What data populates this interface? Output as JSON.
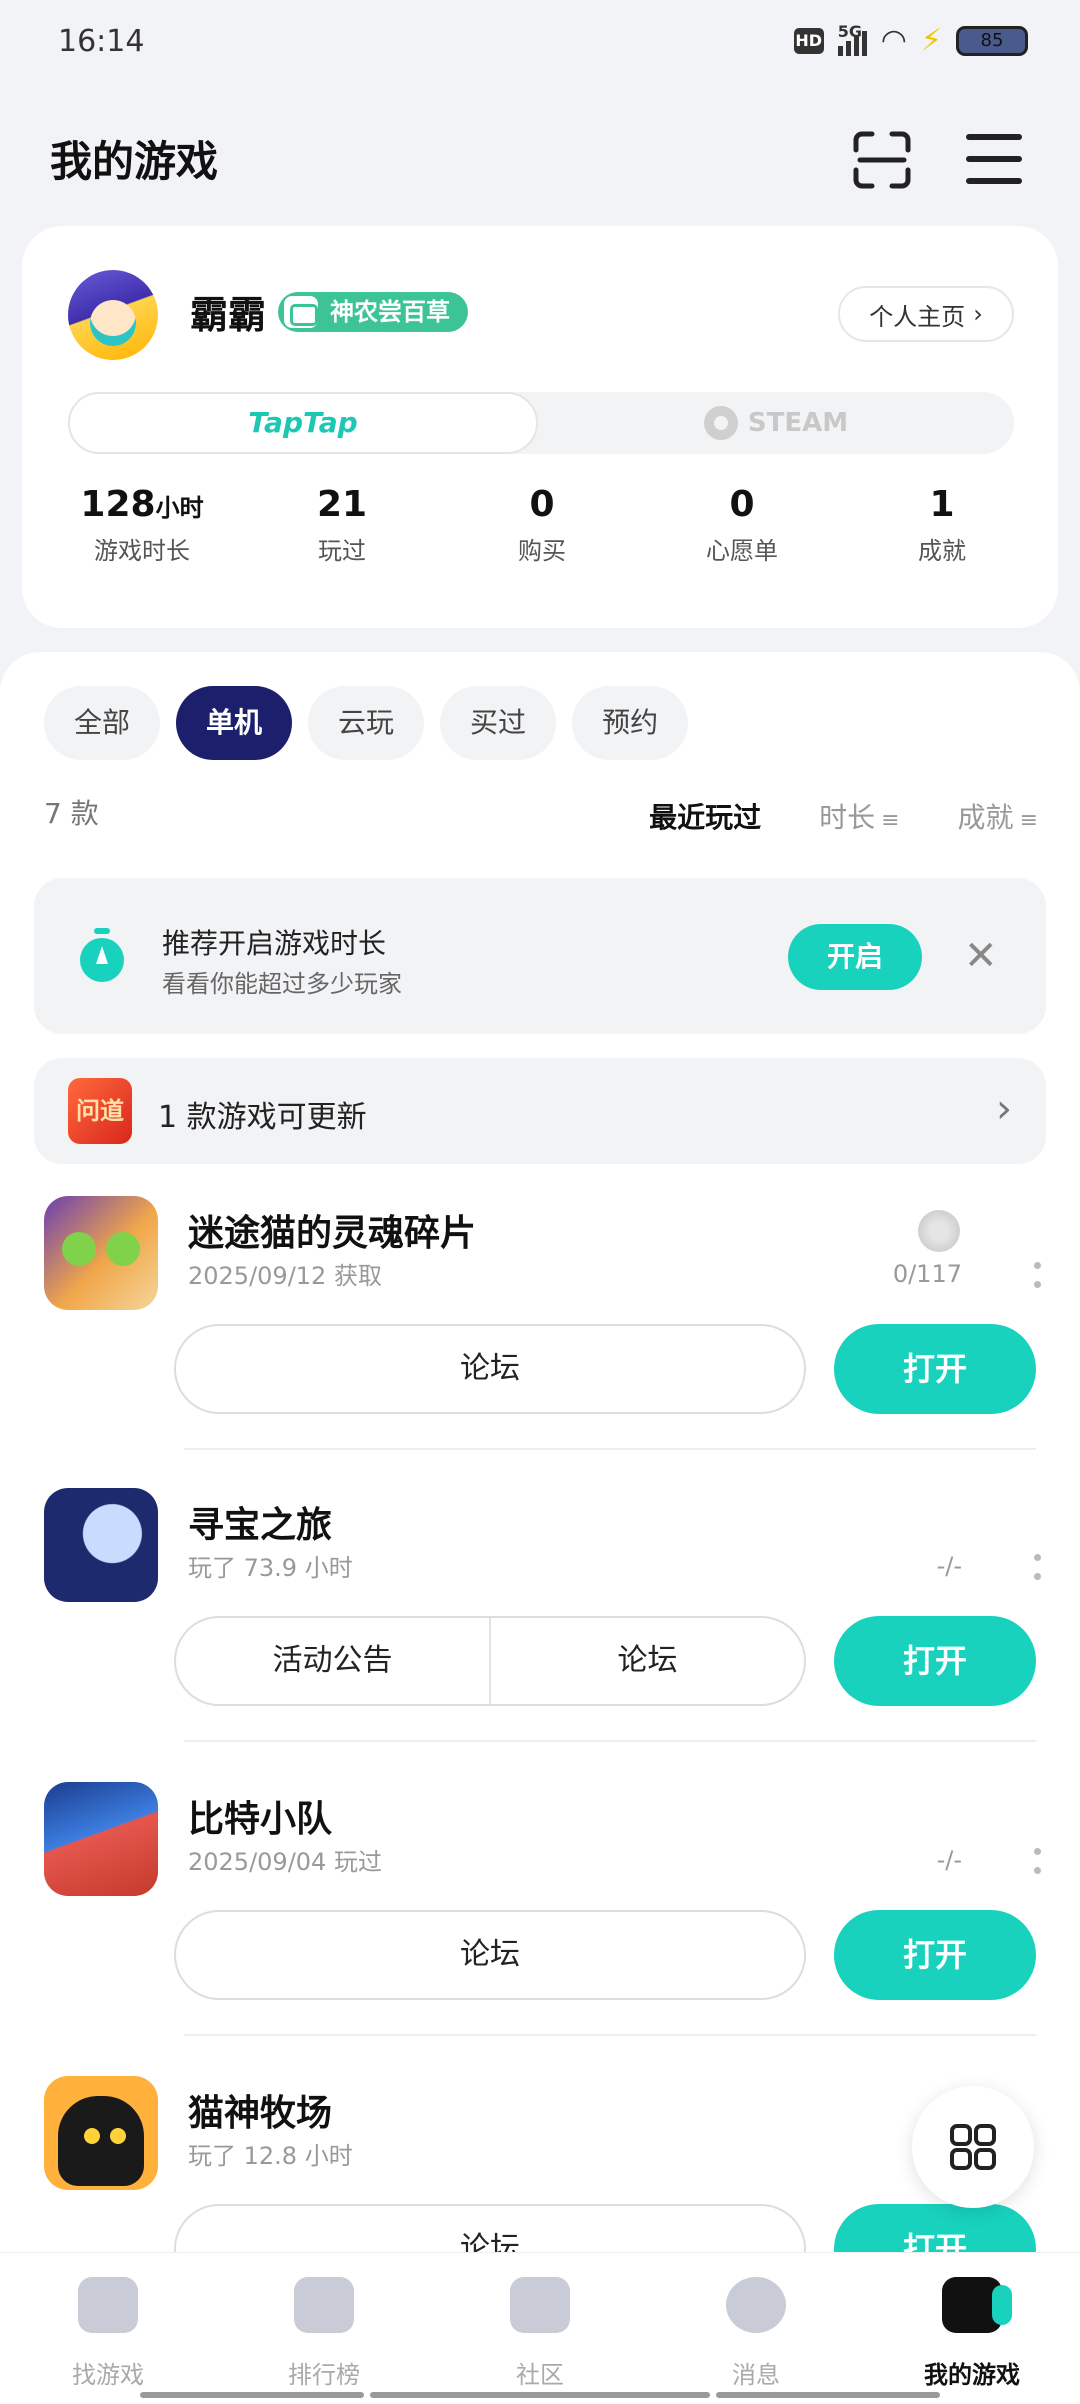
{
  "status_bar": {
    "time": "16:14",
    "network": "5G",
    "hd": "HD",
    "battery": "85"
  },
  "header": {
    "title": "我的游戏"
  },
  "profile": {
    "username": "霸霸",
    "badge": "神农尝百草",
    "home_button": "个人主页",
    "platforms": {
      "taptap": "TapTap",
      "steam": "STEAM",
      "selected": "TapTap"
    },
    "stats": [
      {
        "value": "128",
        "unit": "小时",
        "label": "游戏时长"
      },
      {
        "value": "21",
        "unit": "",
        "label": "玩过"
      },
      {
        "value": "0",
        "unit": "",
        "label": "购买"
      },
      {
        "value": "0",
        "unit": "",
        "label": "心愿单"
      },
      {
        "value": "1",
        "unit": "",
        "label": "成就"
      }
    ]
  },
  "filters": {
    "tabs": [
      {
        "label": "全部",
        "active": false
      },
      {
        "label": "单机",
        "active": true
      },
      {
        "label": "云玩",
        "active": false
      },
      {
        "label": "买过",
        "active": false
      },
      {
        "label": "预约",
        "active": false
      }
    ],
    "count": "7 款",
    "sorts": [
      {
        "label": "最近玩过",
        "active": true
      },
      {
        "label": "时长",
        "active": false
      },
      {
        "label": "成就",
        "active": false
      }
    ]
  },
  "recommend": {
    "title": "推荐开启游戏时长",
    "subtitle": "看看你能超过多少玩家",
    "button": "开启"
  },
  "update": {
    "icon_text": "问道",
    "text": "1 款游戏可更新"
  },
  "games": [
    {
      "name": "迷途猫的灵魂碎片",
      "sub": "2025/09/12 获取",
      "progress": "0/117",
      "buttons": [
        "论坛"
      ],
      "open": "打开"
    },
    {
      "name": "寻宝之旅",
      "sub": "玩了 73.9 小时",
      "progress": "-/-",
      "buttons": [
        "活动公告",
        "论坛"
      ],
      "open": "打开"
    },
    {
      "name": "比特小队",
      "sub": "2025/09/04 玩过",
      "progress": "-/-",
      "buttons": [
        "论坛"
      ],
      "open": "打开"
    },
    {
      "name": "猫神牧场",
      "sub": "玩了 12.8 小时",
      "progress": "",
      "buttons": [
        "论坛"
      ],
      "open": "打开"
    }
  ],
  "bottom_nav": [
    {
      "label": "找游戏",
      "active": false
    },
    {
      "label": "排行榜",
      "active": false
    },
    {
      "label": "社区",
      "active": false
    },
    {
      "label": "消息",
      "active": false
    },
    {
      "label": "我的游戏",
      "active": true
    }
  ],
  "colors": {
    "accent": "#18d2be",
    "active_tab": "#1c1f6b",
    "badge": "#3cc496"
  }
}
